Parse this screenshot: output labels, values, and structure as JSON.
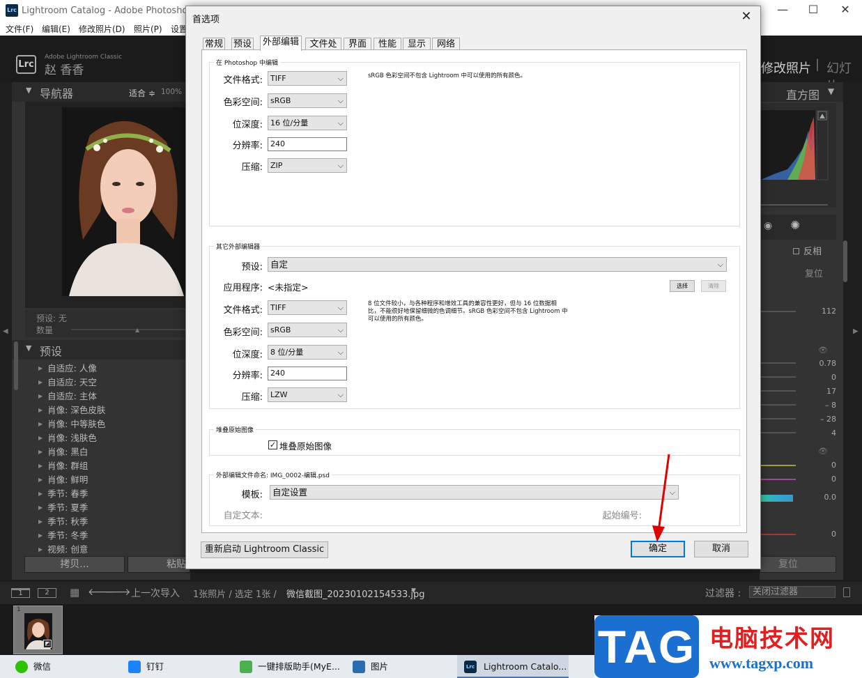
{
  "lr": {
    "app_icon": "Lrc",
    "title": "Lightroom Catalog - Adobe Photoshop L",
    "menu": [
      "文件(F)",
      "编辑(E)",
      "修改照片(D)",
      "照片(P)",
      "设置"
    ],
    "identity_small": "Adobe Lightroom Classic",
    "identity_name": "赵 香香",
    "modules": [
      "修改照片",
      "|",
      "幻灯片"
    ],
    "navigator": {
      "title": "导航器",
      "fit": "适合 ≑",
      "zoom": "100%"
    },
    "preset_info": {
      "preset": "预设: 无",
      "amount": "数量"
    },
    "presets_panel": {
      "title": "预设",
      "items": [
        "自适应: 人像",
        "自适应: 天空",
        "自适应: 主体",
        "肖像: 深色皮肤",
        "肖像: 中等肤色",
        "肖像: 浅肤色",
        "肖像: 黑白",
        "肖像: 群组",
        "肖像: 鲜明",
        "季节: 春季",
        "季节: 夏季",
        "季节: 秋季",
        "季节: 冬季",
        "视频: 创意"
      ]
    },
    "copy_btn": "拷贝...",
    "paste_btn": "粘贴",
    "right": {
      "histogram": "直方图",
      "invert": "反相",
      "reset_small": "复位",
      "values": [
        "112",
        "0.78",
        "0",
        "17",
        "– 8",
        "– 28",
        "4",
        "0",
        "0",
        "0.0",
        "0"
      ],
      "reset_btn": "复位"
    },
    "filmstrip_bar": {
      "screen1": "1",
      "screen2": "2",
      "source": "上一次导入",
      "count": "1张照片 / 选定 1张 /",
      "filename": "微信截图_20230102154533.jpg",
      "filter_label": "过滤器 :",
      "filter_value": "关闭过滤器"
    },
    "thumb_index": "1"
  },
  "taskbar": {
    "items": [
      {
        "label": "微信",
        "color": "#2dc100"
      },
      {
        "label": "钉钉",
        "color": "#1a84ff"
      },
      {
        "label": "一键排版助手(MyE...",
        "color": "#4caf50"
      },
      {
        "label": "图片",
        "color": "#2b6cb0"
      },
      {
        "label": "Lightroom Catalo...",
        "color": "#0b2a4a"
      }
    ]
  },
  "watermark": {
    "tag": "TAG",
    "cn": "电脑技术网",
    "url": "www.tagxp.com"
  },
  "dialog": {
    "title": "首选项",
    "tabs": [
      "常规",
      "预设",
      "外部编辑",
      "文件处理",
      "界面",
      "性能",
      "显示",
      "网络"
    ],
    "active_tab": 2,
    "ps_group": {
      "title": "在 Photoshop 中编辑",
      "file_format_label": "文件格式:",
      "file_format": "TIFF",
      "color_space_label": "色彩空间:",
      "color_space": "sRGB",
      "bit_depth_label": "位深度:",
      "bit_depth": "16 位/分量",
      "resolution_label": "分辨率:",
      "resolution": "240",
      "compression_label": "压缩:",
      "compression": "ZIP",
      "note": "sRGB 色彩空间不包含 Lightroom 中可以使用的所有颜色。"
    },
    "other_group": {
      "title": "其它外部编辑器",
      "preset_label": "预设:",
      "preset": "自定",
      "app_label": "应用程序:",
      "app": "<未指定>",
      "choose_btn": "选择",
      "clear_btn": "清除",
      "file_format_label": "文件格式:",
      "file_format": "TIFF",
      "color_space_label": "色彩空间:",
      "color_space": "sRGB",
      "bit_depth_label": "位深度:",
      "bit_depth": "8 位/分量",
      "resolution_label": "分辨率:",
      "resolution": "240",
      "compression_label": "压缩:",
      "compression": "LZW",
      "note": [
        "8 位文件较小，与各种程序和增效工具的兼容性更好，但与 16 位数据相",
        "比，不能很好地保留细微的色调细节。sRGB 色彩空间不包含 Lightroom 中",
        "可以使用的所有颜色。"
      ]
    },
    "stack_group": {
      "title": "堆叠原始图像",
      "checkbox_label": "堆叠原始图像",
      "checked": "✓"
    },
    "naming_group": {
      "title": "外部编辑文件命名: IMG_0002-编辑.psd",
      "template_label": "模板:",
      "template": "自定设置",
      "custom_text_label": "自定文本:",
      "start_number_label": "起始编号:"
    },
    "restart_btn": "重新启动 Lightroom Classic",
    "ok_btn": "确定",
    "cancel_btn": "取消"
  },
  "colors": {
    "ok_border": "#0078d7",
    "arrow": "#e00000",
    "tag_blue": "#1a6fd1",
    "watermark_red": "#e02020"
  }
}
